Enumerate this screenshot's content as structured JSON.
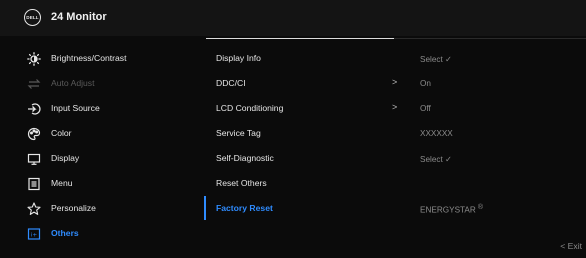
{
  "header": {
    "logo_text": "DELL",
    "title": "24 Monitor"
  },
  "menu": [
    {
      "label": "Brightness/Contrast",
      "icon": "brightness-icon",
      "state": "normal"
    },
    {
      "label": "Auto Adjust",
      "icon": "auto-adjust-icon",
      "state": "disabled"
    },
    {
      "label": "Input Source",
      "icon": "input-source-icon",
      "state": "normal"
    },
    {
      "label": "Color",
      "icon": "color-palette-icon",
      "state": "normal"
    },
    {
      "label": "Display",
      "icon": "display-icon",
      "state": "normal"
    },
    {
      "label": "Menu",
      "icon": "menu-icon",
      "state": "normal"
    },
    {
      "label": "Personalize",
      "icon": "star-icon",
      "state": "normal"
    },
    {
      "label": "Others",
      "icon": "others-icon",
      "state": "active"
    }
  ],
  "submenu": [
    {
      "label": "Display Info",
      "value": "Select ✓",
      "has_arrow": false
    },
    {
      "label": "DDC/CI",
      "value": "On",
      "has_arrow": true
    },
    {
      "label": "LCD Conditioning",
      "value": "Off",
      "has_arrow": true
    },
    {
      "label": "Service Tag",
      "value": "XXXXXX",
      "has_arrow": false
    },
    {
      "label": "Self-Diagnostic",
      "value": "Select ✓",
      "has_arrow": false
    },
    {
      "label": "Reset Others",
      "value": "",
      "has_arrow": false
    },
    {
      "label": "Factory Reset",
      "value": "ENERGYSTAR",
      "value_mark": "®",
      "has_arrow": false,
      "active": true
    }
  ],
  "footer": {
    "exit_label": "< Exit"
  },
  "colors": {
    "accent": "#2f8cff",
    "background": "#0b0b0b",
    "header": "#141414",
    "disabled": "#5a5a5a"
  }
}
